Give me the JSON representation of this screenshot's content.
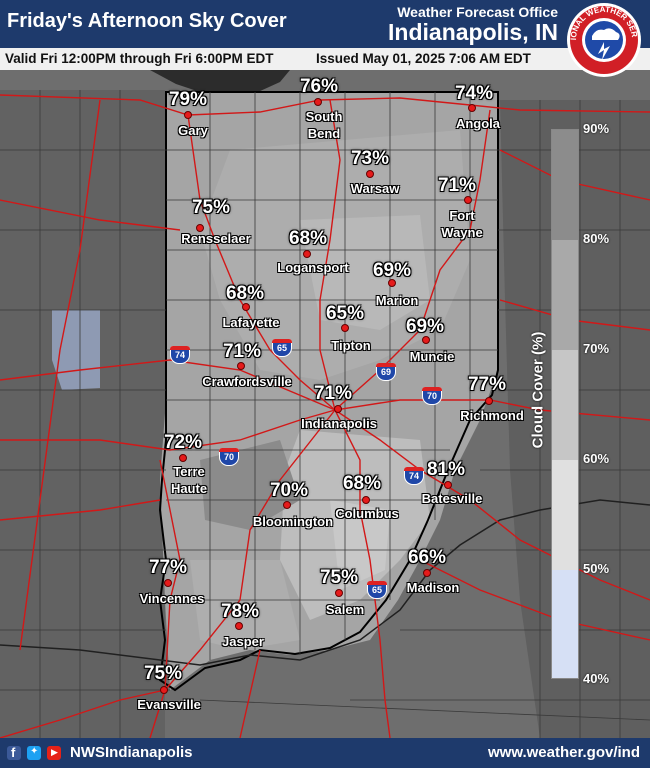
{
  "header": {
    "title": "Friday's Afternoon Sky Cover",
    "office_line1": "Weather Forecast Office",
    "office_line2": "Indianapolis, IN",
    "seal_text": "NATIONAL WEATHER SERVICE"
  },
  "subheader": {
    "valid": "Valid Fri 12:00PM through Fri 6:00PM EDT",
    "issued": "Issued May 01, 2025 7:06 AM EDT"
  },
  "legend": {
    "title": "Cloud Cover (%)",
    "ticks": [
      "90%",
      "80%",
      "70%",
      "60%",
      "50%",
      "40%"
    ],
    "colors": [
      "#8c8c8c",
      "#a9a9a9",
      "#c6c6c6",
      "#e0e0e0",
      "#d6e0f5"
    ]
  },
  "interstates": [
    "74",
    "65",
    "69",
    "70",
    "70",
    "74",
    "65"
  ],
  "cities": [
    {
      "name": "Gary",
      "value": "79%"
    },
    {
      "name": "South Bend",
      "value": "76%"
    },
    {
      "name": "Angola",
      "value": "74%"
    },
    {
      "name": "Warsaw",
      "value": "73%"
    },
    {
      "name": "Fort Wayne",
      "value": "71%"
    },
    {
      "name": "Rensselaer",
      "value": "75%"
    },
    {
      "name": "Logansport",
      "value": "68%"
    },
    {
      "name": "Marion",
      "value": "69%"
    },
    {
      "name": "Lafayette",
      "value": "68%"
    },
    {
      "name": "Tipton",
      "value": "65%"
    },
    {
      "name": "Muncie",
      "value": "69%"
    },
    {
      "name": "Crawfordsville",
      "value": "71%"
    },
    {
      "name": "Indianapolis",
      "value": "71%"
    },
    {
      "name": "Richmond",
      "value": "77%"
    },
    {
      "name": "Terre Haute",
      "value": "72%"
    },
    {
      "name": "Bloomington",
      "value": "70%"
    },
    {
      "name": "Columbus",
      "value": "68%"
    },
    {
      "name": "Batesville",
      "value": "81%"
    },
    {
      "name": "Vincennes",
      "value": "77%"
    },
    {
      "name": "Madison",
      "value": "66%"
    },
    {
      "name": "Salem",
      "value": "75%"
    },
    {
      "name": "Jasper",
      "value": "78%"
    },
    {
      "name": "Evansville",
      "value": "75%"
    }
  ],
  "footer": {
    "handle": "NWSIndianapolis",
    "website": "www.weather.gov/ind",
    "social_icons": [
      "facebook-icon",
      "twitter-icon",
      "youtube-icon"
    ]
  }
}
